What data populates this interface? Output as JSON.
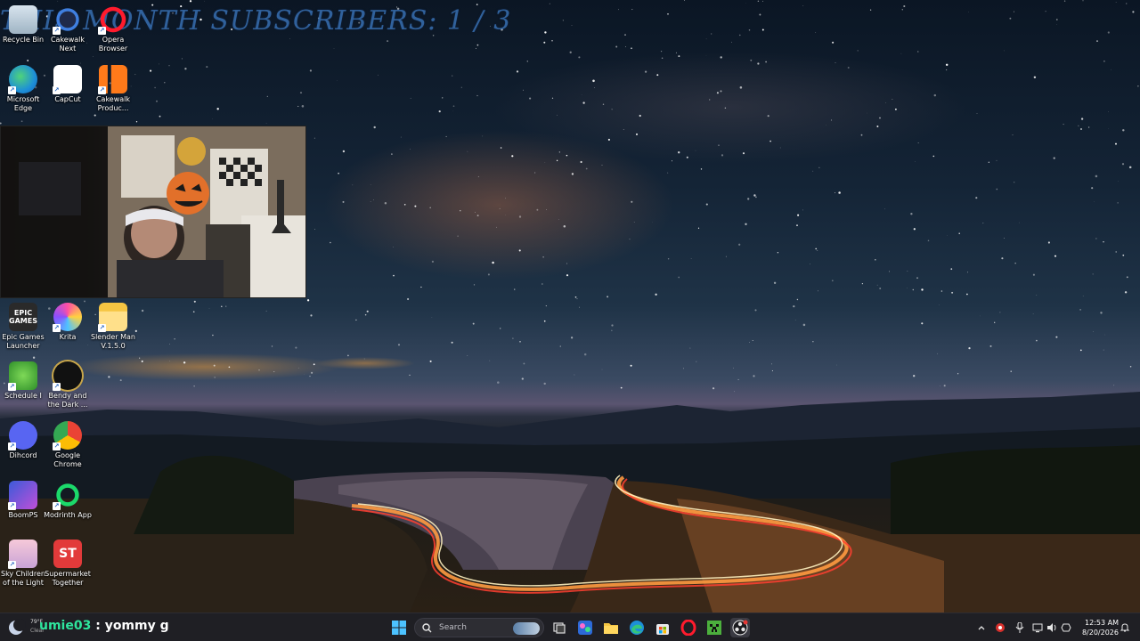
{
  "overlay": {
    "title": "THIS MONTH SUBSCRIBERS: 1 / 3"
  },
  "desktop_icons": [
    {
      "label": "Recycle Bin",
      "icon": "recycle-bin-icon"
    },
    {
      "label": "Cakewalk Next",
      "icon": "cakewalk-next-icon"
    },
    {
      "label": "Opera Browser",
      "icon": "opera-icon"
    },
    {
      "label": "Microsoft Edge",
      "icon": "edge-icon"
    },
    {
      "label": "CapCut",
      "icon": "capcut-icon"
    },
    {
      "label": "Cakewalk Produc...",
      "icon": "cakewalk-producer-icon"
    },
    {
      "label": "Epic Games Launcher",
      "icon": "epic-games-icon",
      "glyph": "EPIC\nGAMES"
    },
    {
      "label": "Krita",
      "icon": "krita-icon"
    },
    {
      "label": "Slender Man V.1.5.0",
      "icon": "folder-icon"
    },
    {
      "label": "Schedule I",
      "icon": "schedule-i-icon"
    },
    {
      "label": "Bendy and the Dark ...",
      "icon": "bendy-icon"
    },
    {
      "label": "Dihcord",
      "icon": "discord-icon"
    },
    {
      "label": "Google Chrome",
      "icon": "chrome-icon"
    },
    {
      "label": "BoomPS",
      "icon": "boomps-icon"
    },
    {
      "label": "Modrinth App",
      "icon": "modrinth-icon"
    },
    {
      "label": "Sky Children of the Light",
      "icon": "sky-icon"
    },
    {
      "label": "Supermarket Together",
      "icon": "supermarket-icon",
      "glyph": "ST"
    }
  ],
  "taskbar": {
    "chat_user": "umie03",
    "chat_message": " : yommy g",
    "weather": {
      "temp": "79°F",
      "condition": "Clear"
    },
    "search_placeholder": "Search",
    "clock_time": "12:53 AM",
    "clock_date": "8/20/2026"
  },
  "colors": {
    "taskbar_bg": "#1f1f24",
    "overlay_text": "#3c78be",
    "chat_user": "#2ee59d"
  }
}
